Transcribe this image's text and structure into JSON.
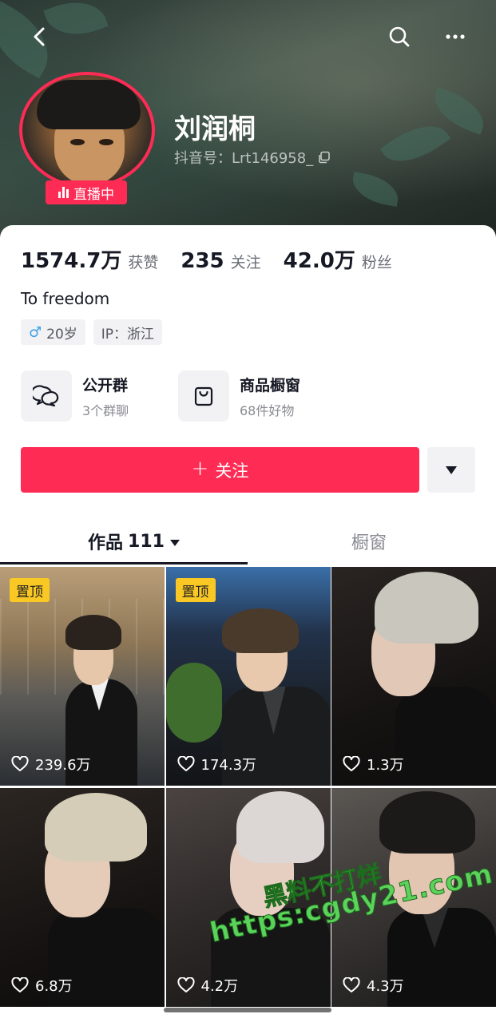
{
  "header": {
    "username": "刘润桐",
    "douyin_id": "抖音号：Lrt146958_",
    "live_badge": "直播中"
  },
  "stats": [
    {
      "value": "1574.7万",
      "label": "获赞"
    },
    {
      "value": "235",
      "label": "关注"
    },
    {
      "value": "42.0万",
      "label": "粉丝"
    }
  ],
  "bio": "To freedom",
  "tags": {
    "gender_symbol": "♂",
    "age": "20岁",
    "ip": "IP：浙江"
  },
  "entries": [
    {
      "title": "公开群",
      "subtitle": "3个群聊",
      "icon": "chat-bubbles-icon"
    },
    {
      "title": "商品橱窗",
      "subtitle": "68件好物",
      "icon": "shopping-bag-icon"
    }
  ],
  "follow_button": {
    "plus": "+",
    "label": "关注"
  },
  "tabs": {
    "works_label": "作品",
    "works_count": "111",
    "window_label": "橱窗"
  },
  "videos": [
    {
      "likes": "239.6万",
      "pinned": "置顶"
    },
    {
      "likes": "174.3万",
      "pinned": "置顶"
    },
    {
      "likes": "1.3万",
      "pinned": ""
    },
    {
      "likes": "6.8万",
      "pinned": ""
    },
    {
      "likes": "4.2万",
      "pinned": ""
    },
    {
      "likes": "4.3万",
      "pinned": ""
    }
  ],
  "watermark": {
    "line1": "黑料不打烊",
    "line2": "https:cgdy21.com"
  },
  "colors": {
    "accent": "#fe2c55",
    "pin_badge": "#f9c825",
    "text_primary": "#161823",
    "text_secondary": "#8a8b91"
  }
}
